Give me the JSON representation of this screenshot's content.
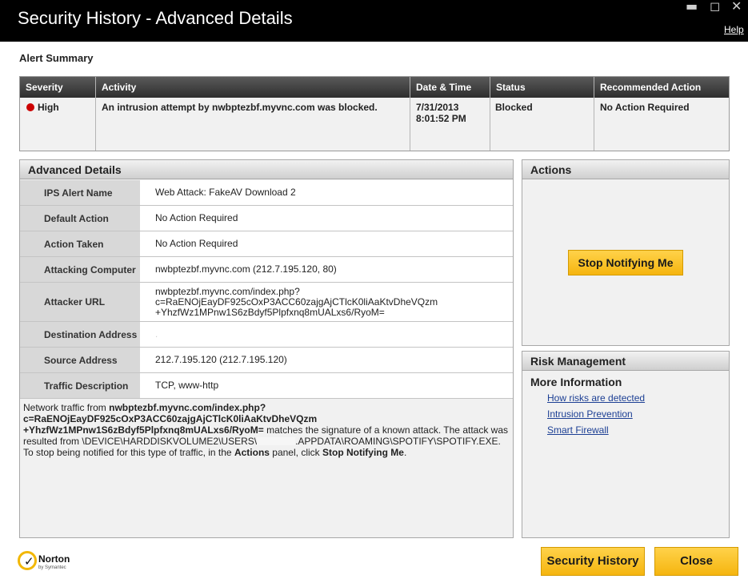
{
  "window": {
    "title": "Security History - Advanced Details",
    "help_label": "Help",
    "minimize_icon": "minimize-icon",
    "maximize_icon": "maximize-icon",
    "close_icon": "close-icon"
  },
  "alert_summary": {
    "heading": "Alert Summary",
    "columns": [
      "Severity",
      "Activity",
      "Date & Time",
      "Status",
      "Recommended Action"
    ],
    "row": {
      "severity": "High",
      "severity_color": "#cc0000",
      "activity": "An intrusion attempt by nwbptezbf.myvnc.com was blocked.",
      "date": "7/31/2013",
      "time": "8:01:52 PM",
      "status": "Blocked",
      "recommended_action": "No Action Required"
    }
  },
  "advanced_details": {
    "heading": "Advanced Details",
    "rows": [
      {
        "label": "IPS Alert Name",
        "value": "Web Attack: FakeAV Download 2"
      },
      {
        "label": "Default Action",
        "value": "No Action Required"
      },
      {
        "label": "Action Taken",
        "value": "No Action Required"
      },
      {
        "label": "Attacking Computer",
        "value": "nwbptezbf.myvnc.com (212.7.195.120, 80)"
      },
      {
        "label": "Attacker URL",
        "value_lines": [
          "nwbptezbf.myvnc.com/index.php?",
          "c=RaENOjEayDF925cOxP3ACC60zajgAjCTlcK0liAaKtvDheVQzm",
          "+YhzfWz1MPnw1S6zBdyf5Plpfxnq8mUALxs6/RyoM="
        ]
      },
      {
        "label": "Destination Address",
        "value": "."
      },
      {
        "label": "Source Address",
        "value": "212.7.195.120 (212.7.195.120)"
      },
      {
        "label": "Traffic Description",
        "value": "TCP, www-http"
      }
    ],
    "description": {
      "p1": "Network traffic from ",
      "url_bold": "nwbptezbf.myvnc.com/index.php?\nc=RaENOjEayDF925cOxP3ACC60zajgAjCTlcK0liAaKtvDheVQzm\n+YhzfWz1MPnw1S6zBdyf5Plpfxnq8mUALxs6/RyoM=",
      "p2": " matches the signature of a known attack. The attack was resulted from \\DEVICE\\HARDDISKVOLUME2\\USERS\\",
      "p3": ".APPDATA\\ROAMING\\SPOTIFY\\SPOTIFY.EXE. To stop being notified for this type of traffic, in the ",
      "actions_bold": "Actions",
      "p4": " panel, click ",
      "stop_bold": "Stop Notifying Me",
      "p5": "."
    }
  },
  "actions_panel": {
    "heading": "Actions",
    "stop_button": "Stop Notifying Me"
  },
  "risk_panel": {
    "heading": "Risk Management",
    "more_info": "More Information",
    "links": [
      "How risks are detected",
      "Intrusion Prevention",
      "Smart Firewall"
    ]
  },
  "footer": {
    "logo_word": "Norton",
    "logo_sub": "by Symantec",
    "logo_icon": "norton-check-icon",
    "security_history_button": "Security History",
    "close_button": "Close"
  },
  "colors": {
    "accent_yellow": "#f5b50f",
    "header_dark": "#2e2e2e",
    "link_blue": "#1c3f94"
  }
}
